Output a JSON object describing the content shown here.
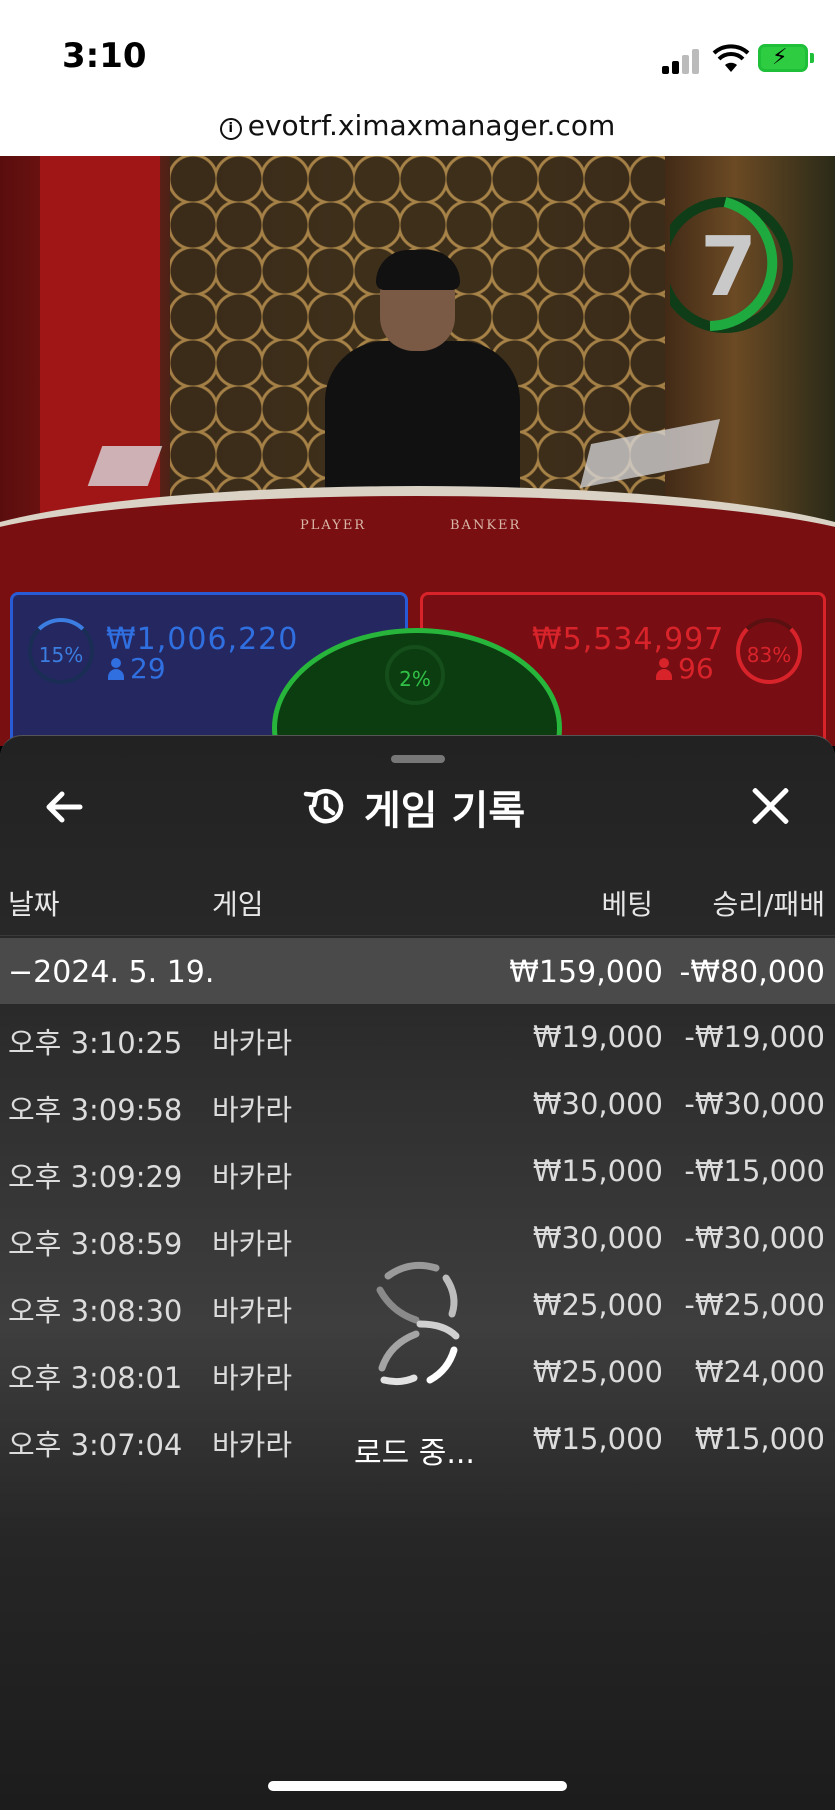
{
  "status_bar": {
    "time": "3:10"
  },
  "browser": {
    "url": "evotrf.ximaxmanager.com"
  },
  "game_view": {
    "timer": "7",
    "player": {
      "percent": "15%",
      "amount": "₩1,006,220",
      "count": "29",
      "color": "#2f6fe0"
    },
    "banker": {
      "percent": "83%",
      "amount": "₩5,534,997",
      "count": "96",
      "color": "#d8232a"
    },
    "tie": {
      "percent": "2%",
      "color": "#32c147"
    },
    "table_labels": {
      "player": "PLAYER",
      "banker": "BANKER"
    }
  },
  "history": {
    "title": "게임 기록",
    "columns": {
      "date": "날짜",
      "game": "게임",
      "bet": "베팅",
      "win_loss": "승리/패배"
    },
    "date_group": {
      "label": "−2024. 5. 19.",
      "bet": "₩159,000",
      "win_loss": "-₩80,000"
    },
    "rows": [
      {
        "time": "오후 3:10:25",
        "game": "바카라",
        "bet": "₩19,000",
        "win_loss": "-₩19,000"
      },
      {
        "time": "오후 3:09:58",
        "game": "바카라",
        "bet": "₩30,000",
        "win_loss": "-₩30,000"
      },
      {
        "time": "오후 3:09:29",
        "game": "바카라",
        "bet": "₩15,000",
        "win_loss": "-₩15,000"
      },
      {
        "time": "오후 3:08:59",
        "game": "바카라",
        "bet": "₩30,000",
        "win_loss": "-₩30,000"
      },
      {
        "time": "오후 3:08:30",
        "game": "바카라",
        "bet": "₩25,000",
        "win_loss": "-₩25,000"
      },
      {
        "time": "오후 3:08:01",
        "game": "바카라",
        "bet": "₩25,000",
        "win_loss": "₩24,000"
      },
      {
        "time": "오후 3:07:04",
        "game": "바카라",
        "bet": "₩15,000",
        "win_loss": "₩15,000"
      }
    ],
    "loading_text": "로드 중..."
  },
  "icons": {
    "back": "arrow-left-icon",
    "history": "history-icon",
    "close": "close-icon",
    "loader": "spinner-icon"
  }
}
